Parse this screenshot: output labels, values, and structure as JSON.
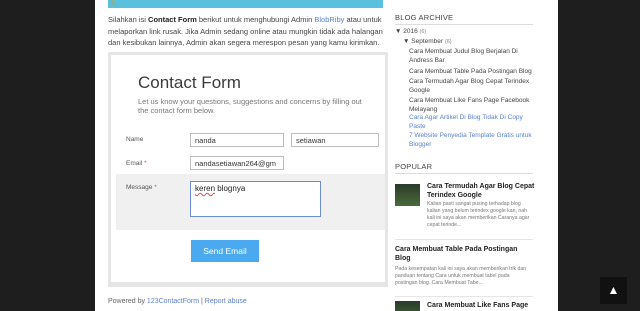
{
  "intro": {
    "p1": "Silahkan isi ",
    "bold": "Contact Form",
    "p2": " berikut untuk menghubungi Admin ",
    "link": "BlobRiby",
    "p3": " atau untuk melaporkan link rusak. Jika Admin sedang online atau mungkin tidak ada halangan dan kesibukan lainnya, Admin akan segera merespon pesan yang kamu kirimkan."
  },
  "form": {
    "title": "Contact Form",
    "subtitle": "Let us know your questions, suggestions and concerns by filling out the contact form below.",
    "name_label": "Name",
    "first_name": "nanda",
    "last_name": "setiawan",
    "email_label": "Email",
    "required_mark": "*",
    "email_value": "nandasetiawan264@gm",
    "message_label": "Message",
    "message_word1": "keren",
    "message_word2": " blognya",
    "send_label": "Send Email"
  },
  "footer": {
    "powered_by": "Powered by ",
    "brand": "123ContactForm",
    "separator": " | ",
    "report": "Report abuse"
  },
  "sidebar": {
    "archive_heading": "BLOG ARCHIVE",
    "year": "2016",
    "year_count": "(6)",
    "month": "September",
    "month_count": "(6)",
    "posts": [
      "Cara Membuat Judul Blog Berjalan Di Andress Bar",
      "Cara Membuat Table Pada Postingan Blog",
      "Cara Termudah Agar Blog Cepat Terindex Google",
      "Cara Membuat Like Fans Page Facebook Melayang",
      "Cara Agar Artikel Di Blog Tidak Di Copy Paste",
      "7 Website Penyedia Template Gratis untuk Blogger"
    ],
    "popular_heading": "POPULAR",
    "popular": [
      {
        "title": "Cara Termudah Agar Blog Cepat Terindex Google",
        "desc": "Kalian pasti sangat pusing terhadap blog kalian yang belum terindex google kan, nah kali ini saya akan memberikan Caranya agar cepat terinde..."
      },
      {
        "title": "Cara Membuat Table Pada Postingan Blog",
        "desc": "Pada kesempatan kali ini saya akan memberikan trik dan panduan tentang Cara untuk membuat tabel pada postingan blog. Cara Membuat Tabe..."
      },
      {
        "title": "Cara Membuat Like Fans Page",
        "desc": ""
      }
    ]
  },
  "icons": {
    "to_top": "arrow-up-icon",
    "expand": "triangle-down-icon"
  }
}
